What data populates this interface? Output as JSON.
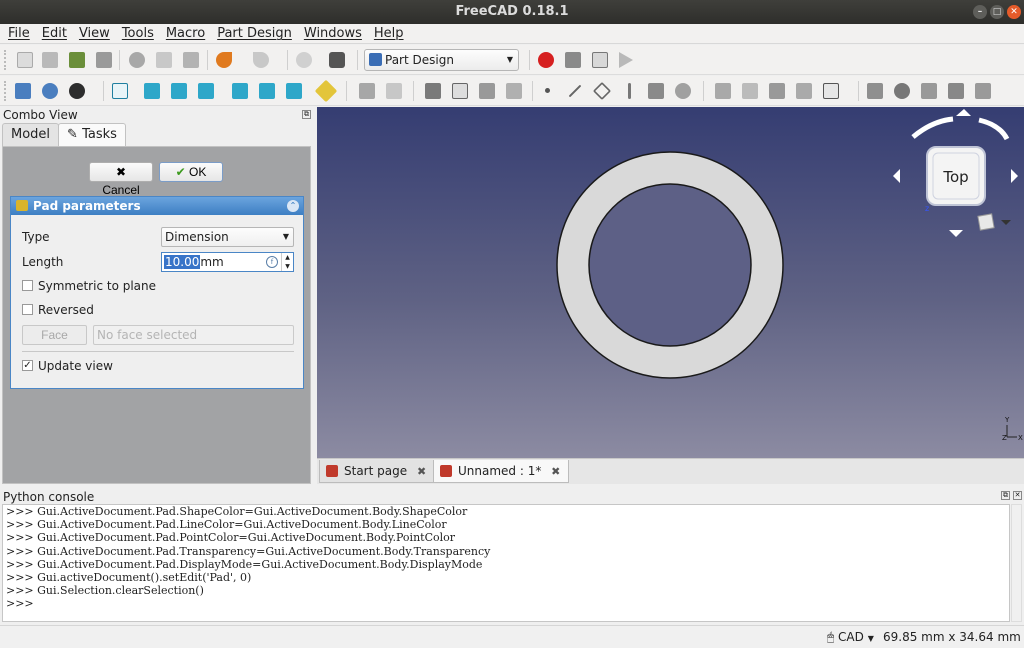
{
  "window": {
    "title": "FreeCAD 0.18.1"
  },
  "menu": [
    "File",
    "Edit",
    "View",
    "Tools",
    "Macro",
    "Part Design",
    "Windows",
    "Help"
  ],
  "toolbar": {
    "workbench": "Part Design"
  },
  "combo_view": {
    "title": "Combo View",
    "tabs": [
      {
        "label": "Model"
      },
      {
        "label": "Tasks"
      }
    ],
    "cancel_label": "Cancel",
    "ok_label": "OK",
    "pad": {
      "title": "Pad parameters",
      "type_label": "Type",
      "type_value": "Dimension",
      "length_label": "Length",
      "length_value": "10.00",
      "length_unit": "mm",
      "symmetric_label": "Symmetric to plane",
      "reversed_label": "Reversed",
      "face_button": "Face",
      "face_placeholder": "No face selected",
      "update_view_label": "Update view",
      "symmetric_checked": false,
      "reversed_checked": false,
      "update_view_checked": true
    }
  },
  "view3d": {
    "navcube_face": "Top"
  },
  "doc_tabs": [
    {
      "label": "Start page"
    },
    {
      "label": "Unnamed : 1*"
    }
  ],
  "console": {
    "title": "Python console",
    "lines": [
      ">>> Gui.ActiveDocument.Pad.ShapeColor=Gui.ActiveDocument.Body.ShapeColor",
      ">>> Gui.ActiveDocument.Pad.LineColor=Gui.ActiveDocument.Body.LineColor",
      ">>> Gui.ActiveDocument.Pad.PointColor=Gui.ActiveDocument.Body.PointColor",
      ">>> Gui.ActiveDocument.Pad.Transparency=Gui.ActiveDocument.Body.Transparency",
      ">>> Gui.ActiveDocument.Pad.DisplayMode=Gui.ActiveDocument.Body.DisplayMode",
      ">>> Gui.activeDocument().setEdit('Pad', 0)",
      ">>> Gui.Selection.clearSelection()",
      ">>>"
    ]
  },
  "status": {
    "nav_style": "CAD",
    "coordinates": "69.85 mm x 34.64 mm"
  }
}
